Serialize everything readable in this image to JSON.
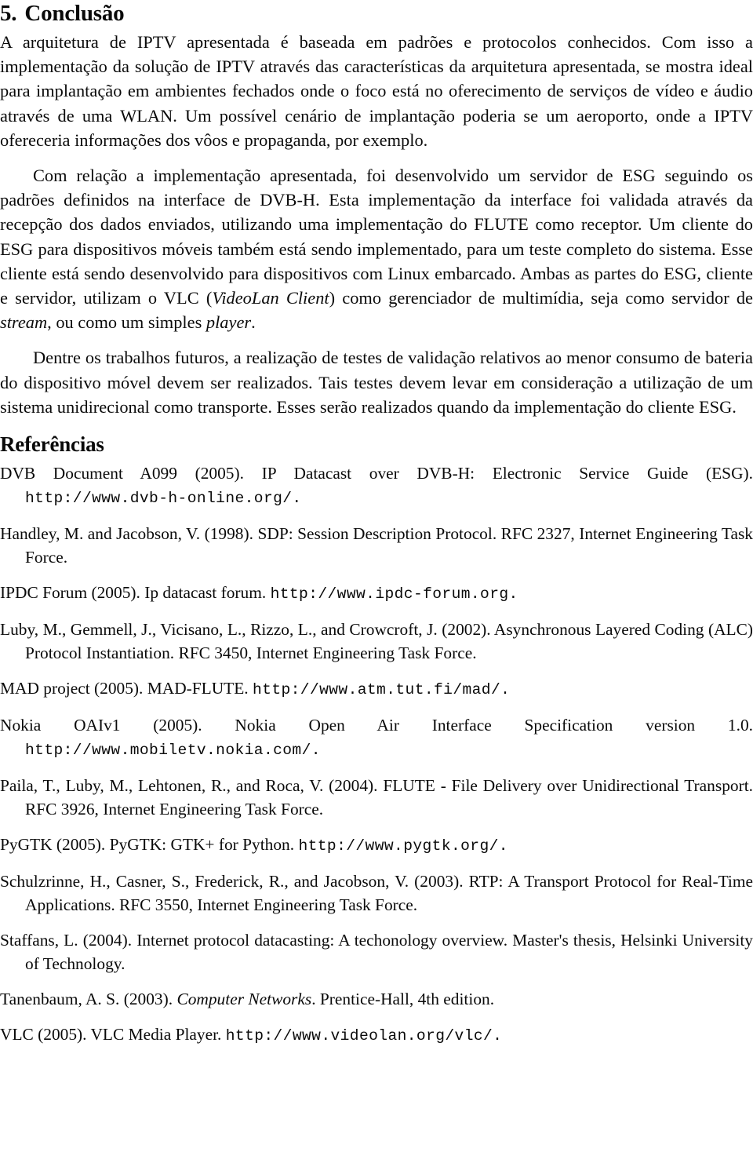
{
  "document": {
    "section_number": "5.",
    "section_title": "Conclusão",
    "references_title": "Referências"
  },
  "conclusion": {
    "paragraphs": [
      {
        "id": "p1",
        "indented": false,
        "runs": [
          {
            "style": "normal",
            "text": "A arquitetura de IPTV apresentada é baseada em padrões e protocolos conhecidos. Com isso a implementação da solução de IPTV através das características da arquitetura apresentada, se mostra ideal para implantação em ambientes fechados onde o foco está no oferecimento de serviços de vídeo e áudio através de uma WLAN. Um possível cenário de implantação poderia se um aeroporto, onde a IPTV ofereceria informações dos vôos e propaganda, por exemplo."
          }
        ]
      },
      {
        "id": "p2",
        "indented": true,
        "runs": [
          {
            "style": "normal",
            "text": "Com relação a implementação apresentada, foi desenvolvido um servidor de ESG seguindo os padrões definidos na interface de DVB-H. Esta implementação da interface foi validada através da recepção dos dados enviados, utilizando uma implementação do FLUTE como receptor. Um cliente do ESG para dispositivos móveis também está sendo implementado, para um teste completo do sistema. Esse cliente está sendo desenvolvido para dispositivos com Linux embarcado. Ambas as partes do ESG, cliente e servidor, utilizam o VLC ("
          },
          {
            "style": "italic",
            "text": "VideoLan Client"
          },
          {
            "style": "normal",
            "text": ") como gerenciador de multimídia, seja como servidor de "
          },
          {
            "style": "italic",
            "text": "stream"
          },
          {
            "style": "normal",
            "text": ", ou como um simples "
          },
          {
            "style": "italic",
            "text": "player"
          },
          {
            "style": "normal",
            "text": "."
          }
        ]
      },
      {
        "id": "p3",
        "indented": true,
        "runs": [
          {
            "style": "normal",
            "text": "Dentre os trabalhos futuros, a realização de testes de validação relativos ao menor consumo de bateria do dispositivo móvel devem ser realizados. Tais testes devem levar em consideração a utilização de um sistema unidirecional como transporte. Esses serão realizados quando da implementação do cliente ESG."
          }
        ]
      }
    ]
  },
  "references": [
    {
      "id": "ref-dvb-a099",
      "runs": [
        {
          "style": "normal",
          "text": "DVB Document A099 (2005). IP Datacast over DVB-H: Electronic Service Guide (ESG). "
        },
        {
          "style": "url",
          "text": "http://www.dvb-h-online.org/."
        }
      ]
    },
    {
      "id": "ref-handley",
      "runs": [
        {
          "style": "normal",
          "text": "Handley, M. and Jacobson, V. (1998).  SDP: Session Description Protocol.  RFC 2327, Internet Engineering Task Force."
        }
      ]
    },
    {
      "id": "ref-ipdc-forum",
      "runs": [
        {
          "style": "normal",
          "text": "IPDC Forum (2005). Ip datacast forum. "
        },
        {
          "style": "url",
          "text": "http://www.ipdc-forum.org."
        }
      ]
    },
    {
      "id": "ref-luby",
      "runs": [
        {
          "style": "normal",
          "text": "Luby, M., Gemmell, J., Vicisano, L., Rizzo, L., and Crowcroft, J. (2002).  Asynchronous Layered Coding (ALC) Protocol Instantiation.  RFC 3450, Internet Engineering Task Force."
        }
      ]
    },
    {
      "id": "ref-mad-project",
      "runs": [
        {
          "style": "normal",
          "text": "MAD project (2005). MAD-FLUTE. "
        },
        {
          "style": "url",
          "text": "http://www.atm.tut.fi/mad/."
        }
      ]
    },
    {
      "id": "ref-nokia-oaiv1",
      "runs": [
        {
          "style": "normal",
          "text": "Nokia OAIv1 (2005).  Nokia Open Air Interface Specification version 1.0.  "
        },
        {
          "style": "url",
          "text": "http://www.mobiletv.nokia.com/."
        }
      ]
    },
    {
      "id": "ref-paila",
      "runs": [
        {
          "style": "normal",
          "text": "Paila, T., Luby, M., Lehtonen, R., and Roca, V. (2004). FLUTE - File Delivery over Unidirectional Transport. RFC 3926, Internet Engineering Task Force."
        }
      ]
    },
    {
      "id": "ref-pygtk",
      "runs": [
        {
          "style": "normal",
          "text": "PyGTK (2005). PyGTK: GTK+ for Python. "
        },
        {
          "style": "url",
          "text": "http://www.pygtk.org/."
        }
      ]
    },
    {
      "id": "ref-schulzrinne",
      "runs": [
        {
          "style": "normal",
          "text": "Schulzrinne, H., Casner, S., Frederick, R., and Jacobson, V. (2003).  RTP: A Transport Protocol for Real-Time Applications. RFC 3550, Internet Engineering Task Force."
        }
      ]
    },
    {
      "id": "ref-staffans",
      "runs": [
        {
          "style": "normal",
          "text": "Staffans, L. (2004).  Internet protocol datacasting: A techonology overview.  Master's thesis, Helsinki University of Technology."
        }
      ]
    },
    {
      "id": "ref-tanenbaum",
      "runs": [
        {
          "style": "normal",
          "text": "Tanenbaum, A. S. (2003). "
        },
        {
          "style": "italic",
          "text": "Computer Networks"
        },
        {
          "style": "normal",
          "text": ". Prentice-Hall, 4th edition."
        }
      ]
    },
    {
      "id": "ref-vlc",
      "runs": [
        {
          "style": "normal",
          "text": "VLC (2005). VLC Media Player. "
        },
        {
          "style": "url",
          "text": "http://www.videolan.org/vlc/."
        }
      ]
    }
  ]
}
